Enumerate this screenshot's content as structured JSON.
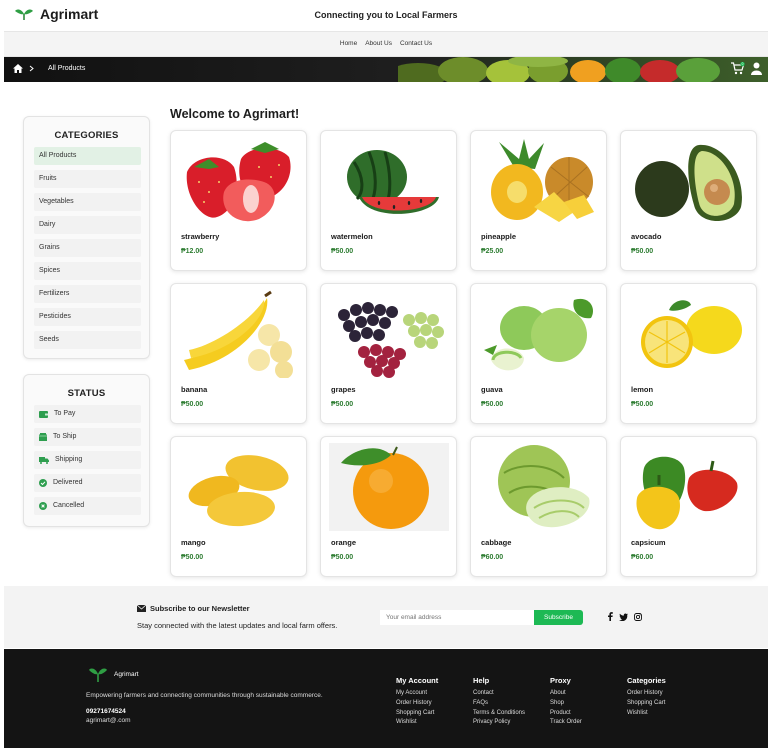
{
  "header": {
    "brand": "Agrimart",
    "tagline": "Connecting you to Local Farmers"
  },
  "nav": {
    "links": [
      "Home",
      "About Us",
      "Contact Us"
    ]
  },
  "banner": {
    "breadcrumb": "All Products",
    "cart_count": "0"
  },
  "sidebar": {
    "categories_title": "CATEGORIES",
    "categories": [
      "All Products",
      "Fruits",
      "Vegetables",
      "Dairy",
      "Grains",
      "Spices",
      "Fertilizers",
      "Pesticides",
      "Seeds"
    ],
    "active_category": "All Products",
    "status_title": "STATUS",
    "status": [
      {
        "label": "To Pay",
        "icon": "wallet-icon"
      },
      {
        "label": "To Ship",
        "icon": "box-icon"
      },
      {
        "label": "Shipping",
        "icon": "truck-icon"
      },
      {
        "label": "Delivered",
        "icon": "check-circle-icon"
      },
      {
        "label": "Cancelled",
        "icon": "x-circle-icon"
      }
    ]
  },
  "main": {
    "welcome": "Welcome to Agrimart!",
    "products": [
      {
        "name": "strawberry",
        "price": "₱12.00"
      },
      {
        "name": "watermelon",
        "price": "₱50.00"
      },
      {
        "name": "pineapple",
        "price": "₱25.00"
      },
      {
        "name": "avocado",
        "price": "₱50.00"
      },
      {
        "name": "banana",
        "price": "₱50.00"
      },
      {
        "name": "grapes",
        "price": "₱50.00"
      },
      {
        "name": "guava",
        "price": "₱50.00"
      },
      {
        "name": "lemon",
        "price": "₱50.00"
      },
      {
        "name": "mango",
        "price": "₱50.00"
      },
      {
        "name": "orange",
        "price": "₱50.00"
      },
      {
        "name": "cabbage",
        "price": "₱60.00"
      },
      {
        "name": "capsicum",
        "price": "₱60.00"
      }
    ]
  },
  "newsletter": {
    "title": "Subscribe to our Newsletter",
    "subtitle": "Stay connected with the latest updates and local farm offers.",
    "placeholder": "Your email address",
    "button": "Subscribe"
  },
  "footer": {
    "brand": "Agrimart",
    "description": "Empowering farmers and connecting communities through sustainable commerce.",
    "phone": "09271674524",
    "email": "agrimart@.com",
    "columns": [
      {
        "title": "My Account",
        "links": [
          "My Account",
          "Order History",
          "Shopping Cart",
          "Wishlist"
        ]
      },
      {
        "title": "Help",
        "links": [
          "Contact",
          "FAQs",
          "Terms & Conditions",
          "Privacy Policy"
        ]
      },
      {
        "title": "Proxy",
        "links": [
          "About",
          "Shop",
          "Product",
          "Track Order"
        ]
      },
      {
        "title": "Categories",
        "links": [
          "Order History",
          "Shopping Cart",
          "Wishlist"
        ]
      }
    ]
  },
  "colors": {
    "accent": "#1db954",
    "price": "#2e7d32",
    "active_bg": "#e2f1e5",
    "footer_bg": "#141414"
  }
}
